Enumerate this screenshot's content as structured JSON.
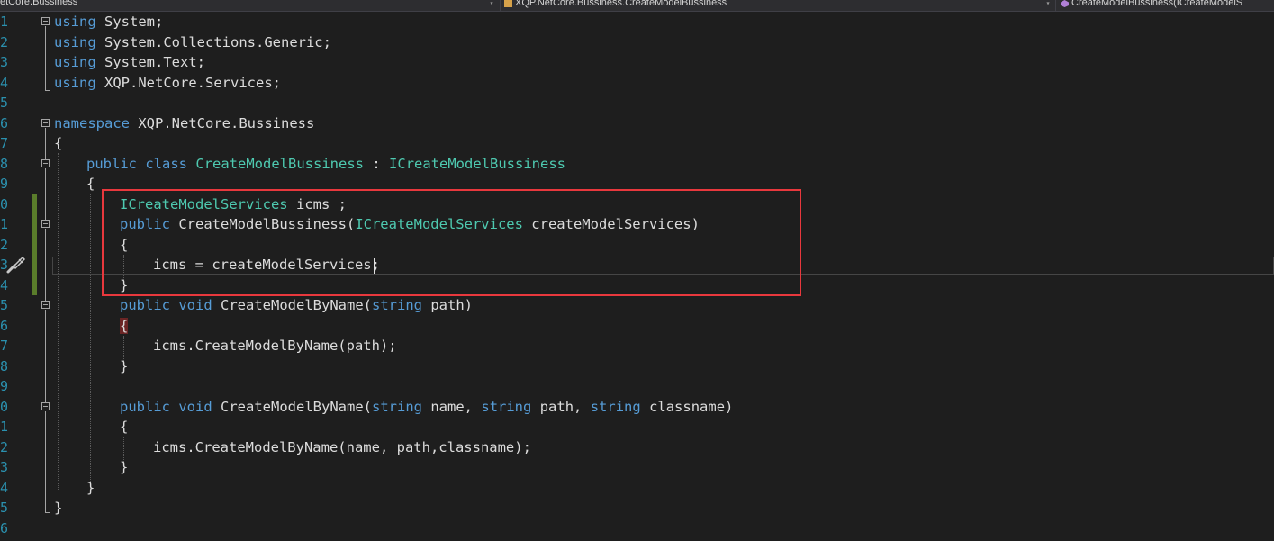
{
  "nav": {
    "project": "etCore.Bussiness",
    "type_member": "XQP.NetCore.Bussiness.CreateModelBussiness",
    "member": "CreateModelBussiness(ICreateModelS",
    "dropdown_glyph": "▾"
  },
  "editor": {
    "accent_highlight": "#e8383d",
    "line_numbers": [
      "1",
      "2",
      "3",
      "4",
      "5",
      "6",
      "7",
      "8",
      "9",
      "0",
      "1",
      "2",
      "3",
      "4",
      "5",
      "6",
      "7",
      "8",
      "9",
      "0",
      "1",
      "2",
      "3",
      "4",
      "5",
      "6"
    ],
    "lines": {
      "l1_kw": "using",
      "l1_rest": "System;",
      "l2_kw": "using",
      "l2_rest": "System.Collections.Generic;",
      "l3_kw": "using",
      "l3_rest": "System.Text;",
      "l4_kw": "using",
      "l4_rest": "XQP.NetCore.Services;",
      "l6_kw": "namespace",
      "l6_rest": "XQP.NetCore.Bussiness",
      "l7_brace": "{",
      "l8_kw1": "public",
      "l8_kw2": "class",
      "l8_cls": "CreateModelBussiness",
      "l8_colon": ":",
      "l8_iface": "ICreateModelBussiness",
      "l9_brace": "{",
      "l10_type": "ICreateModelServices",
      "l10_rest": "icms ;",
      "l11_kw": "public",
      "l11_name": "CreateModelBussiness(",
      "l11_type": "ICreateModelServices",
      "l11_rest": "createModelServices)",
      "l12_brace": "{",
      "l13_code": "icms = createModelServices;",
      "l14_brace": "}",
      "l15_kw1": "public",
      "l15_kw2": "void",
      "l15_name": "CreateModelByName(",
      "l15_kw3": "string",
      "l15_rest": "path)",
      "l16_brace": "{",
      "l17_code": "icms.CreateModelByName(path);",
      "l18_brace": "}",
      "l20_kw1": "public",
      "l20_kw2": "void",
      "l20_name": "CreateModelByName(",
      "l20_kw3": "string",
      "l20_p1": "name,",
      "l20_kw4": "string",
      "l20_p2": "path,",
      "l20_kw5": "string",
      "l20_p3": "classname)",
      "l21_brace": "{",
      "l22_code": "icms.CreateModelByName(name, path,classname);",
      "l23_brace": "}",
      "l24_brace": "}",
      "l25_brace": "}"
    }
  }
}
